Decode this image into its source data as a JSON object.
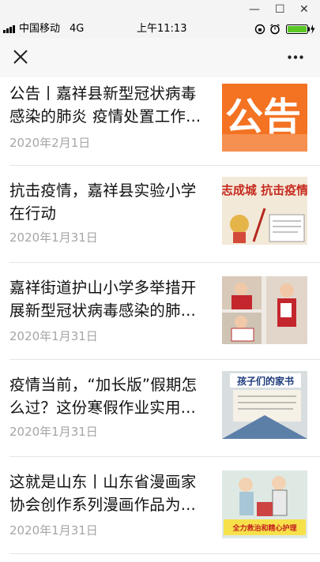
{
  "window": {
    "minimize": "—",
    "maximize": "☐",
    "close": "✕"
  },
  "status": {
    "carrier": "中国移动",
    "network": "4G",
    "time": "上午11:13"
  },
  "nav": {
    "close_icon": "close-icon",
    "more_icon": "more-icon"
  },
  "articles": [
    {
      "title": "公告丨嘉祥县新型冠状病毒感染的肺炎 疫情处置工作...",
      "date": "2020年2月1日",
      "thumb_text": "公告"
    },
    {
      "title": "抗击疫情，嘉祥县实验小学在行动",
      "date": "2020年1月31日",
      "thumb_text": "志成城 抗击疫情"
    },
    {
      "title": "嘉祥街道护山小学多举措开展新型冠状病毒感染的肺...",
      "date": "2020年1月31日"
    },
    {
      "title": "疫情当前，“加长版”假期怎么过？这份寒假作业实用...",
      "date": "2020年1月31日",
      "thumb_text": "孩子们的家书"
    },
    {
      "title": "这就是山东丨山东省漫画家协会创作系列漫画作品为...",
      "date": "2020年1月31日",
      "thumb_text": "全力救治和精心护理"
    }
  ]
}
